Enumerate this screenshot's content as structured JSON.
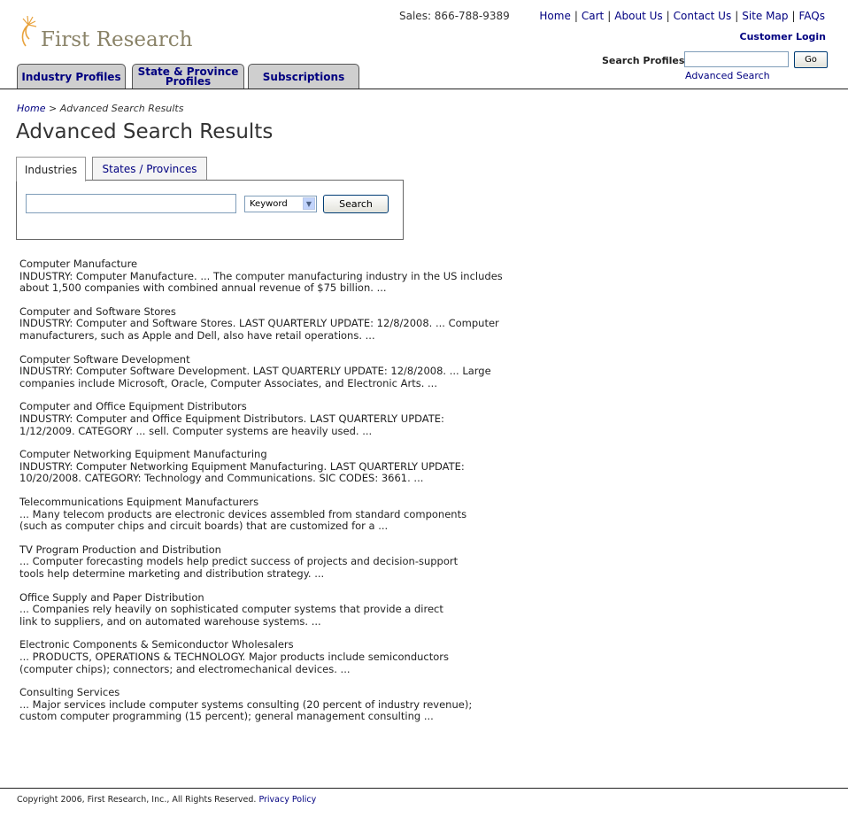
{
  "header": {
    "logo_text": "First Research",
    "sales": "Sales: 866-788-9389",
    "links": [
      "Home",
      "Cart",
      "About Us",
      "Contact Us",
      "Site Map",
      "FAQs"
    ],
    "customer_login": "Customer Login",
    "search_profiles_label": "Search Profiles",
    "search_profiles_value": "",
    "go_label": "Go",
    "advanced_search": "Advanced Search"
  },
  "nav_tabs": [
    {
      "label": "Industry Profiles"
    },
    {
      "label_line1": "State & Province",
      "label_line2": "Profiles"
    },
    {
      "label": "Subscriptions"
    }
  ],
  "breadcrumb": {
    "home": "Home",
    "separator": ">",
    "current": "Advanced Search Results"
  },
  "page_title": "Advanced Search Results",
  "search_form": {
    "tabs": [
      "Industries",
      "States / Provinces"
    ],
    "active_tab": "Industries",
    "keyword_value": "",
    "select_value": "Keyword",
    "button_label": "Search"
  },
  "results": [
    {
      "title": "Computer Manufacture",
      "snippet_1": "INDUSTRY: Computer Manufacture. ... The computer manufacturing industry in the US includes",
      "snippet_2": "about 1,500 companies with combined annual revenue of $75 billion. ..."
    },
    {
      "title": "Computer and Software Stores",
      "snippet_1": "INDUSTRY: Computer and Software Stores. LAST QUARTERLY UPDATE: 12/8/2008. ... Computer",
      "snippet_2": "manufacturers, such as Apple and Dell, also have retail operations. ..."
    },
    {
      "title": "Computer Software Development",
      "snippet_1": "INDUSTRY: Computer Software Development. LAST QUARTERLY UPDATE: 12/8/2008. ... Large",
      "snippet_2": "companies include Microsoft, Oracle, Computer Associates, and Electronic Arts. ..."
    },
    {
      "title": "Computer and Office Equipment Distributors",
      "snippet_1": "INDUSTRY: Computer and Office Equipment Distributors. LAST QUARTERLY UPDATE:",
      "snippet_2": "1/12/2009. CATEGORY ... sell. Computer systems are heavily used. ..."
    },
    {
      "title": "Computer Networking Equipment Manufacturing",
      "snippet_1": "INDUSTRY: Computer Networking Equipment Manufacturing. LAST QUARTERLY UPDATE:",
      "snippet_2": "10/20/2008. CATEGORY: Technology and Communications. SIC CODES: 3661. ..."
    },
    {
      "title": "Telecommunications Equipment Manufacturers",
      "snippet_1": "... Many telecom products are electronic devices assembled from standard components",
      "snippet_2": "(such as computer chips and circuit boards) that are customized for a ..."
    },
    {
      "title": "TV Program Production and Distribution",
      "snippet_1": "... Computer forecasting models help predict success of projects and decision-support",
      "snippet_2": "tools help determine marketing and distribution strategy. ..."
    },
    {
      "title": "Office Supply and Paper Distribution",
      "snippet_1": "... Companies rely heavily on sophisticated computer systems that provide a direct",
      "snippet_2": "link to suppliers, and on automated warehouse systems. ..."
    },
    {
      "title": "Electronic Components & Semiconductor Wholesalers",
      "snippet_1": "... PRODUCTS, OPERATIONS & TECHNOLOGY. Major products include semiconductors",
      "snippet_2": "(computer chips); connectors; and electromechanical devices. ..."
    },
    {
      "title": "Consulting Services",
      "snippet_1": "... Major services include computer systems consulting (20 percent of industry revenue);",
      "snippet_2": "custom computer programming (15 percent); general management consulting ..."
    }
  ],
  "footer": {
    "copyright": "Copyright 2006, First Research, Inc., All Rights Reserved.",
    "privacy": "Privacy Policy"
  },
  "colors": {
    "link": "#000080",
    "logo_text": "#8a8368",
    "logo_accent": "#e8a23c",
    "tab_bg": "#cfcfcf"
  }
}
